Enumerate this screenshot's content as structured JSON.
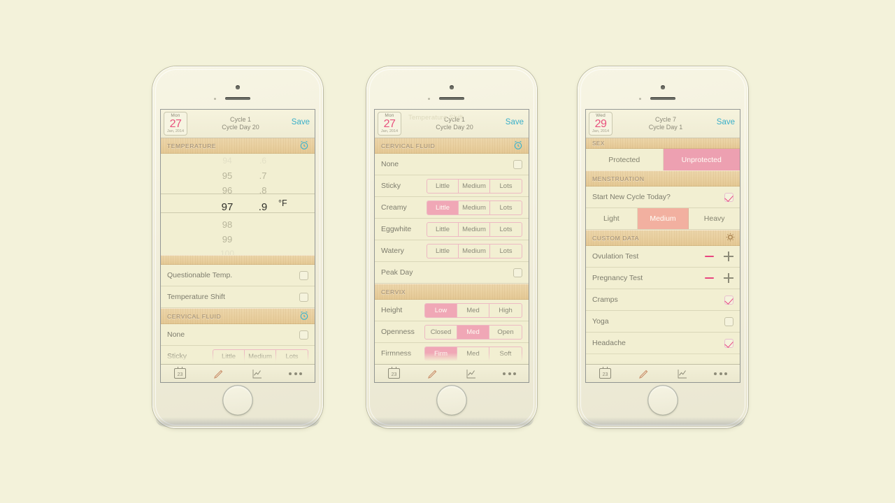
{
  "background_color": "#f3f2da",
  "accent": {
    "pink": "#e8457f",
    "seg_pink": "#f0a7b6",
    "teal": "#3aafc9",
    "salmon": "#f2b0a0",
    "wood": "#e9d0a0"
  },
  "phones": [
    {
      "name": "phone-1-temperature",
      "navbar": {
        "date": {
          "dow": "Mon",
          "day": "27",
          "month_year": "Jan, 2014"
        },
        "cycle": "Cycle 1",
        "cycle_day": "Cycle Day 20",
        "save_label": "Save"
      },
      "sections": [
        {
          "label": "TEMPERATURE",
          "icon": "alarm-clock-icon"
        },
        {
          "label": "CERVICAL FLUID",
          "icon": "alarm-clock-icon"
        }
      ],
      "picker": {
        "whole": [
          "94",
          "95",
          "96",
          "97",
          "98",
          "99",
          "100"
        ],
        "decimal": [
          ".6",
          ".7",
          ".8",
          ".9",
          "",
          "",
          ""
        ],
        "selected_whole": "97",
        "selected_decimal": ".9",
        "unit": "°F"
      },
      "checkbox_rows": [
        {
          "label": "Questionable Temp.",
          "checked": false
        },
        {
          "label": "Temperature Shift",
          "checked": false
        },
        {
          "label": "None",
          "checked": false
        }
      ],
      "partial_row": {
        "label": "Sticky",
        "options": [
          "Little",
          "Medium",
          "Lots"
        ]
      }
    },
    {
      "name": "phone-2-cervical-fluid",
      "navbar": {
        "date": {
          "dow": "Mon",
          "day": "27",
          "month_year": "Jan, 2014"
        },
        "cycle": "Cycle 1",
        "cycle_day": "Cycle Day 20",
        "save_label": "Save"
      },
      "ghost_text": "Temperature Shift",
      "cervical_fluid": {
        "section_label": "CERVICAL FLUID",
        "section_icon": "alarm-clock-icon",
        "none": {
          "label": "None",
          "checked": false
        },
        "amount_options": [
          "Little",
          "Medium",
          "Lots"
        ],
        "rows": [
          {
            "label": "Sticky",
            "selected": null
          },
          {
            "label": "Creamy",
            "selected": "Little"
          },
          {
            "label": "Eggwhite",
            "selected": null
          },
          {
            "label": "Watery",
            "selected": null
          }
        ],
        "peak_day": {
          "label": "Peak Day",
          "checked": false
        }
      },
      "cervix": {
        "section_label": "CERVIX",
        "rows": [
          {
            "label": "Height",
            "options": [
              "Low",
              "Med",
              "High"
            ],
            "selected": "Low"
          },
          {
            "label": "Openness",
            "options": [
              "Closed",
              "Med",
              "Open"
            ],
            "selected": "Med"
          },
          {
            "label": "Firmness",
            "options": [
              "Firm",
              "Med",
              "Soft"
            ],
            "selected": "Firm"
          }
        ]
      }
    },
    {
      "name": "phone-3-sex-menstruation",
      "navbar": {
        "date": {
          "dow": "Wed",
          "day": "29",
          "month_year": "Jan, 2014"
        },
        "cycle": "Cycle 7",
        "cycle_day": "Cycle Day 1",
        "save_label": "Save"
      },
      "sex": {
        "section_label": "SEX",
        "options": [
          "Protected",
          "Unprotected"
        ],
        "selected": "Unprotected"
      },
      "menstruation": {
        "section_label": "MENSTRUATION",
        "start_new_cycle": {
          "label": "Start New Cycle Today?",
          "checked": true
        },
        "flow_options": [
          "Light",
          "Medium",
          "Heavy"
        ],
        "flow_selected": "Medium"
      },
      "custom_data": {
        "section_label": "CUSTOM DATA",
        "section_icon": "gear-icon",
        "counter_rows": [
          {
            "label": "Ovulation Test"
          },
          {
            "label": "Pregnancy Test"
          }
        ],
        "check_rows": [
          {
            "label": "Cramps",
            "checked": true
          },
          {
            "label": "Yoga",
            "checked": false
          },
          {
            "label": "Headache",
            "checked": true
          }
        ]
      }
    }
  ],
  "toolbar": {
    "calendar_label": "23",
    "items": [
      "calendar-icon",
      "pencil-icon",
      "chart-icon",
      "more-icon"
    ]
  }
}
